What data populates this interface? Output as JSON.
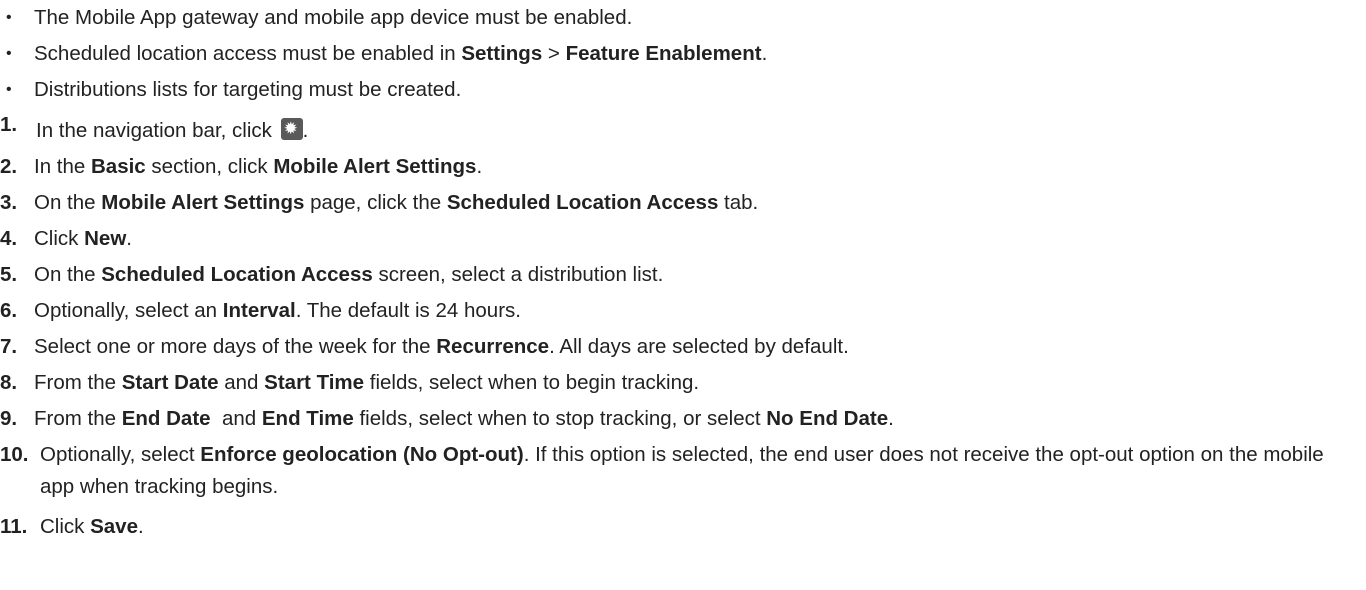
{
  "prerequisites": [
    {
      "text": "The Mobile App gateway and mobile app device must be enabled."
    },
    {
      "prefix": "Scheduled location access must be enabled in ",
      "b1": "Settings",
      "mid": " > ",
      "b2": "Feature Enablement",
      "suffix": "."
    },
    {
      "text": "Distributions lists for targeting must be created."
    }
  ],
  "bullet_glyph": "•",
  "steps": [
    {
      "num": "1.",
      "prefix": "In the navigation bar, click ",
      "icon": "gear-icon",
      "suffix": "."
    },
    {
      "num": "2.",
      "p1": "In the ",
      "b1": "Basic",
      "p2": " section, click ",
      "b2": "Mobile Alert Settings",
      "p3": "."
    },
    {
      "num": "3.",
      "p1": "On the ",
      "b1": "Mobile Alert Settings",
      "p2": " page, click the ",
      "b2": "Scheduled Location Access",
      "p3": " tab."
    },
    {
      "num": "4.",
      "p1": "Click ",
      "b1": "New",
      "p2": "."
    },
    {
      "num": "5.",
      "p1": "On the ",
      "b1": "Scheduled Location Access",
      "p2": " screen, select a distribution list."
    },
    {
      "num": "6.",
      "p1": "Optionally, select an ",
      "b1": "Interval",
      "p2": ". The default is 24 hours."
    },
    {
      "num": "7.",
      "p1": "Select one or more days of the week for the ",
      "b1": "Recurrence",
      "p2": ". All days are selected by default."
    },
    {
      "num": "8.",
      "p1": "From the ",
      "b1": "Start Date",
      "p2": " and ",
      "b2": "Start Time",
      "p3": " fields, select when to begin tracking."
    },
    {
      "num": "9.",
      "p1": "From the ",
      "b1": "End Date",
      "p2": "  and ",
      "b2": "End Time",
      "p3": " fields, select when to stop tracking, or select ",
      "b3": "No End Date",
      "p4": "."
    },
    {
      "num": "10.",
      "p1": "Optionally, select ",
      "b1": "Enforce geolocation (No Opt-out)",
      "p2": ". If this option is selected, the end user does not receive the opt-out option on the mobile app when tracking begins."
    },
    {
      "num": "11.",
      "p1": "Click ",
      "b1": "Save",
      "p2": "."
    }
  ]
}
